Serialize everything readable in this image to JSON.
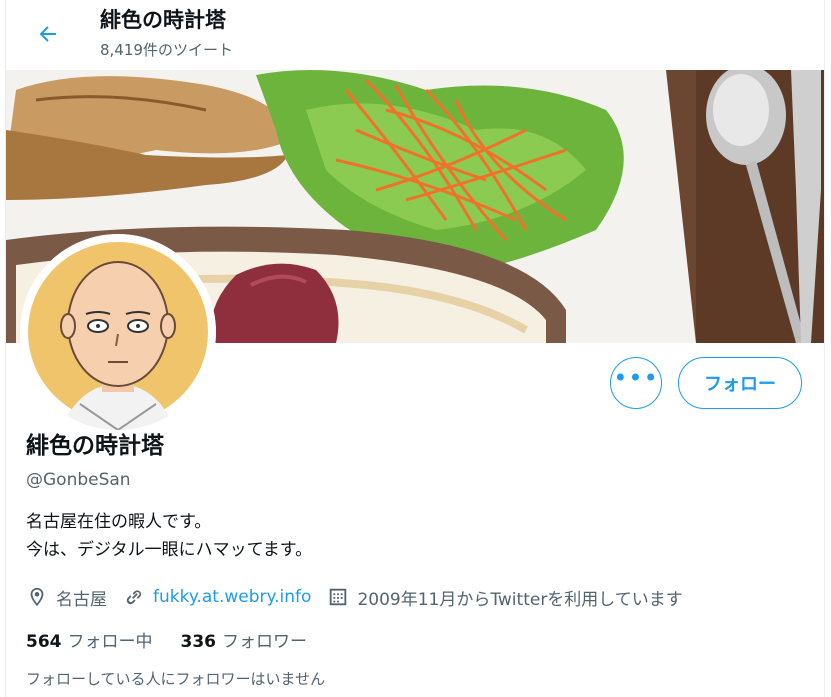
{
  "header": {
    "title": "緋色の時計塔",
    "tweet_count": "8,419件のツイート"
  },
  "profile": {
    "name": "緋色の時計塔",
    "handle": "@GonbeSan",
    "bio_line1": "名古屋在住の暇人です。",
    "bio_line2": "今は、デジタル一眼にハマッてます。",
    "location": "名古屋",
    "url": "fukky.at.webry.info",
    "joined": "2009年11月からTwitterを利用しています",
    "following_count": "564",
    "following_label": "フォロー中",
    "followers_count": "336",
    "followers_label": "フォロワー",
    "followers_you_know": "フォローしている人にフォロワーはいません"
  },
  "actions": {
    "more_icon": "more-icon",
    "follow_label": "フォロー"
  },
  "colors": {
    "accent": "#1d9bf0",
    "secondary_text": "#536471",
    "avatar_bg": "#f0c46a"
  }
}
